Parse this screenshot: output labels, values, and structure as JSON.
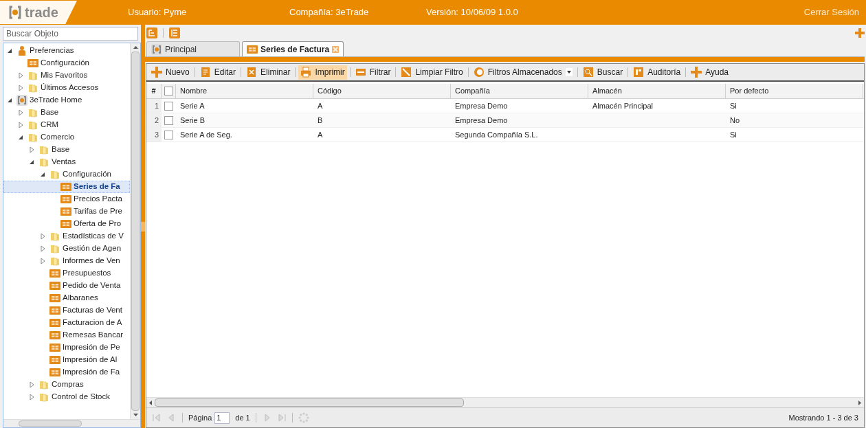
{
  "header": {
    "logo": "trade",
    "user": "Usuario: Pyme",
    "company": "Compañía: 3eTrade",
    "version": "Versión: 10/06/09 1.0.0",
    "logout": "Cerrar Sesión"
  },
  "sidebar": {
    "search": {
      "placeholder": "Buscar Objeto"
    },
    "tree": [
      {
        "label": "Preferencias",
        "kind": "person",
        "expanded": true,
        "selected": false,
        "children": [
          {
            "label": "Configuración",
            "kind": "form",
            "selected": false
          },
          {
            "label": "Mis Favoritos",
            "kind": "folder",
            "expanded": false,
            "selected": false
          },
          {
            "label": "Últimos Accesos",
            "kind": "folder",
            "expanded": false,
            "selected": false
          }
        ]
      },
      {
        "label": "3eTrade Home",
        "kind": "home",
        "expanded": true,
        "selected": false,
        "children": [
          {
            "label": "Base",
            "kind": "folder",
            "expanded": false,
            "selected": false
          },
          {
            "label": "CRM",
            "kind": "folder",
            "expanded": false,
            "selected": false
          },
          {
            "label": "Comercio",
            "kind": "folder",
            "expanded": true,
            "selected": false,
            "children": [
              {
                "label": "Base",
                "kind": "folder",
                "expanded": false,
                "selected": false
              },
              {
                "label": "Ventas",
                "kind": "folder",
                "expanded": true,
                "selected": false,
                "children": [
                  {
                    "label": "Configuración",
                    "kind": "folder",
                    "expanded": true,
                    "selected": false,
                    "children": [
                      {
                        "label": "Series de Fa",
                        "kind": "form",
                        "selected": true
                      },
                      {
                        "label": "Precios Pacta",
                        "kind": "form",
                        "selected": false
                      },
                      {
                        "label": "Tarifas de Pre",
                        "kind": "form",
                        "selected": false
                      },
                      {
                        "label": "Oferta de Pro",
                        "kind": "form",
                        "selected": false
                      }
                    ]
                  },
                  {
                    "label": "Estadísticas de V",
                    "kind": "folder",
                    "expanded": false,
                    "selected": false
                  },
                  {
                    "label": "Gestión de Agen",
                    "kind": "folder",
                    "expanded": false,
                    "selected": false
                  },
                  {
                    "label": "Informes de Ven",
                    "kind": "folder",
                    "expanded": false,
                    "selected": false
                  },
                  {
                    "label": "Presupuestos",
                    "kind": "form",
                    "selected": false
                  },
                  {
                    "label": "Pedido de Venta",
                    "kind": "form",
                    "selected": false
                  },
                  {
                    "label": "Albaranes",
                    "kind": "form",
                    "selected": false
                  },
                  {
                    "label": "Facturas de Vent",
                    "kind": "form",
                    "selected": false
                  },
                  {
                    "label": "Facturacion de A",
                    "kind": "form",
                    "selected": false
                  },
                  {
                    "label": "Remesas Bancar",
                    "kind": "form",
                    "selected": false
                  },
                  {
                    "label": "Impresión de Pe",
                    "kind": "form",
                    "selected": false
                  },
                  {
                    "label": "Impresión de Al",
                    "kind": "form",
                    "selected": false
                  },
                  {
                    "label": "Impresión de Fa",
                    "kind": "form",
                    "selected": false
                  }
                ]
              },
              {
                "label": "Compras",
                "kind": "folder",
                "expanded": false,
                "selected": false
              },
              {
                "label": "Control de Stock",
                "kind": "folder",
                "expanded": false,
                "selected": false
              }
            ]
          }
        ]
      }
    ]
  },
  "tabs": [
    {
      "label": "Principal",
      "kind": "home",
      "selected": false
    },
    {
      "label": "Series de Factura",
      "kind": "form",
      "selected": true
    }
  ],
  "toolbar": [
    {
      "label": "Nuevo",
      "kind": "plus",
      "active": false
    },
    {
      "label": "Editar",
      "kind": "edit",
      "active": false
    },
    {
      "label": "Eliminar",
      "kind": "delete",
      "active": false
    },
    {
      "label": "Imprimir",
      "kind": "print",
      "active": true
    },
    {
      "label": "Filtrar",
      "kind": "filter",
      "active": false
    },
    {
      "label": "Limpiar Filtro",
      "kind": "clear",
      "active": false
    },
    {
      "label": "Filtros Almacenados",
      "kind": "stored",
      "active": false,
      "dropdown": true
    },
    {
      "label": "Buscar",
      "kind": "search",
      "active": false
    },
    {
      "label": "Auditoría",
      "kind": "audit",
      "active": false
    },
    {
      "label": "Ayuda",
      "kind": "plus",
      "active": false
    }
  ],
  "table": {
    "index_header": "#",
    "all_checked": false,
    "columns": [
      "Nombre",
      "Código",
      "Compañía",
      "Almacén",
      "Por defecto"
    ],
    "rows": [
      {
        "index": "1",
        "checked": false,
        "cells": [
          "Serie A",
          "A",
          "Empresa Demo",
          "Almacén Principal",
          "Si"
        ]
      },
      {
        "index": "2",
        "checked": false,
        "cells": [
          "Serie B",
          "B",
          "Empresa Demo",
          "",
          "No"
        ]
      },
      {
        "index": "3",
        "checked": false,
        "cells": [
          "Serie A de Seg.",
          "A",
          "Segunda Compañía S.L.",
          "",
          "Si"
        ]
      }
    ]
  },
  "paging": {
    "page_label": "Página",
    "page": "1",
    "of": "de 1",
    "status": "Mostrando 1 - 3 de 3"
  }
}
